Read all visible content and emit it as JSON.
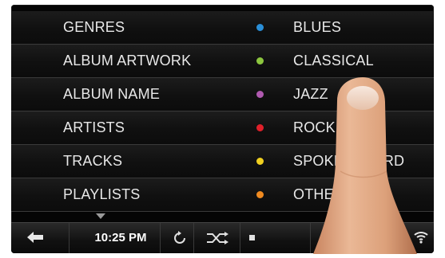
{
  "categories": [
    {
      "label": "GENRES"
    },
    {
      "label": "ALBUM ARTWORK"
    },
    {
      "label": "ALBUM NAME"
    },
    {
      "label": "ARTISTS"
    },
    {
      "label": "TRACKS"
    },
    {
      "label": "PLAYLISTS"
    }
  ],
  "genres": [
    {
      "label": "BLUES",
      "color": "#2a8fd8"
    },
    {
      "label": "CLASSICAL",
      "color": "#8cc63f"
    },
    {
      "label": "JAZZ",
      "color": "#b05ab0"
    },
    {
      "label": "ROCK",
      "color": "#e0202a"
    },
    {
      "label": "SPOKEN WORD",
      "color": "#f0d020"
    },
    {
      "label": "OTHER",
      "color": "#f08a20"
    }
  ],
  "toolbar": {
    "time": "10:25 PM",
    "icons": [
      "back-arrow-icon",
      "repeat-icon",
      "shuffle-icon",
      "stop-icon",
      "wifi-icon"
    ]
  }
}
